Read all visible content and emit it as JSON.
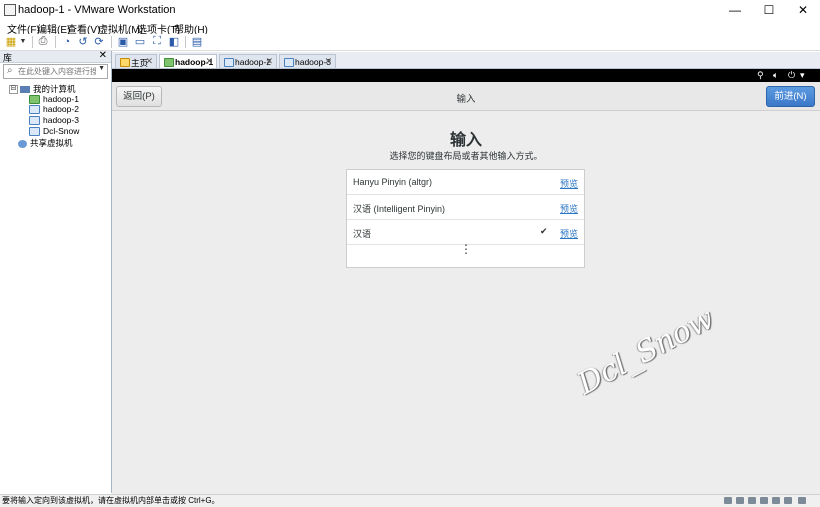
{
  "window": {
    "title": "hadoop-1 - VMware Workstation",
    "controls": {
      "minimize": "—",
      "maximize": "☐",
      "close": "✕"
    }
  },
  "menu": [
    "文件(F)",
    "编辑(E)",
    "查看(V)",
    "虚拟机(M)",
    "选项卡(T)",
    "帮助(H)"
  ],
  "toolbar": {
    "icons": [
      "library-icon",
      "dropdown-icon",
      "print-icon",
      "snapshot-icon",
      "revert-icon",
      "snapshot-manager-icon",
      "console-view-icon",
      "quick-switch-icon",
      "fullscreen-icon",
      "unity-icon",
      "thumbnail-icon"
    ]
  },
  "sidebar": {
    "header": "库",
    "close": "✕",
    "search_placeholder": "在此处键入内容进行搜索",
    "tree": {
      "root": {
        "expander": "⊟",
        "label": "我的计算机"
      },
      "vms": [
        "hadoop-1",
        "hadoop-2",
        "hadoop-3",
        "Dcl-Snow"
      ],
      "shared": "共享虚拟机"
    }
  },
  "tabs": [
    {
      "label": "主页",
      "close": "✕",
      "active": false
    },
    {
      "label": "hadoop-1",
      "close": "✕",
      "active": true
    },
    {
      "label": "hadoop-2",
      "close": "✕",
      "active": false
    },
    {
      "label": "hadoop-3",
      "close": "✕",
      "active": false
    }
  ],
  "vm": {
    "tray": {
      "network": "network-icon",
      "volume": "volume-icon",
      "power": "power-icon",
      "power_caret": "▾"
    },
    "back_label": "返回(P)",
    "header_title": "输入",
    "next_label": "前进(N)",
    "page_title": "输入",
    "page_subtitle": "选择您的键盘布局或者其他输入方式。",
    "input_sources": [
      {
        "name": "Hanyu Pinyin (altgr)",
        "selected": false,
        "preview": "预览"
      },
      {
        "name": "汉语 (Intelligent Pinyin)",
        "selected": false,
        "preview": "预览"
      },
      {
        "name": "汉语",
        "selected": true,
        "preview": "预览"
      }
    ],
    "check_mark": "✔",
    "more": "⋮",
    "watermark": "Dcl_Snow",
    "colors": {
      "next_button": "#3b78c8",
      "link": "#2a76c6",
      "topbar": "#000000"
    }
  },
  "statusbar": {
    "message": "要将输入定向到该虚拟机，请在虚拟机内部单击或按 Ctrl+G。"
  }
}
